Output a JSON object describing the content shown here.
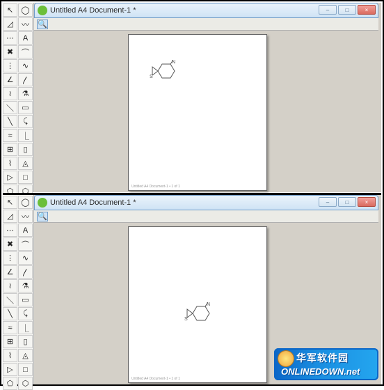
{
  "window": {
    "title": "Untitled A4 Document-1 *",
    "min_label": "–",
    "max_label": "□",
    "close_label": "×"
  },
  "toolstrip": {
    "zoom_icon": "🔍"
  },
  "toolbox": {
    "tools": [
      {
        "name": "pointer",
        "glyph": "↖",
        "sel": false
      },
      {
        "name": "lasso",
        "glyph": "◯",
        "sel": false
      },
      {
        "name": "eraser",
        "glyph": "◿",
        "sel": false
      },
      {
        "name": "brush",
        "glyph": "〰",
        "sel": false
      },
      {
        "name": "dotted1",
        "glyph": "⋯",
        "sel": false
      },
      {
        "name": "text",
        "glyph": "A",
        "sel": false
      },
      {
        "name": "delete",
        "glyph": "✖",
        "sel": false
      },
      {
        "name": "arc",
        "glyph": "⌒",
        "sel": false
      },
      {
        "name": "dots",
        "glyph": "⋮",
        "sel": false
      },
      {
        "name": "curve",
        "glyph": "∿",
        "sel": false
      },
      {
        "name": "angle",
        "glyph": "∠",
        "sel": false
      },
      {
        "name": "bend",
        "glyph": "〳",
        "sel": false
      },
      {
        "name": "chain",
        "glyph": "≀",
        "sel": false
      },
      {
        "name": "flask",
        "glyph": "⚗",
        "sel": false
      },
      {
        "name": "line",
        "glyph": "＼",
        "sel": false
      },
      {
        "name": "rect",
        "glyph": "▭",
        "sel": false
      },
      {
        "name": "line2",
        "glyph": "╲",
        "sel": false
      },
      {
        "name": "hook",
        "glyph": "⤹",
        "sel": false
      },
      {
        "name": "wave",
        "glyph": "≈",
        "sel": false
      },
      {
        "name": "el",
        "glyph": "⎿",
        "sel": false
      },
      {
        "name": "grid",
        "glyph": "⊞",
        "sel": false
      },
      {
        "name": "page",
        "glyph": "▯",
        "sel": false
      },
      {
        "name": "zig",
        "glyph": "⌇",
        "sel": false
      },
      {
        "name": "ring",
        "glyph": "◬",
        "sel": false
      },
      {
        "name": "play",
        "glyph": "▷",
        "sel": false
      },
      {
        "name": "sq",
        "glyph": "□",
        "sel": false
      },
      {
        "name": "pent",
        "glyph": "⬠",
        "sel": false
      },
      {
        "name": "hex",
        "glyph": "⬡",
        "sel": false
      }
    ]
  },
  "paper": {
    "footer": "Untitled A4 Document-1 • 1 of 1"
  },
  "molecule": {
    "atom1": "N",
    "atom2": "S"
  },
  "watermark": {
    "cn": "华军软件园",
    "en": "ONLINEDOWN.net"
  }
}
